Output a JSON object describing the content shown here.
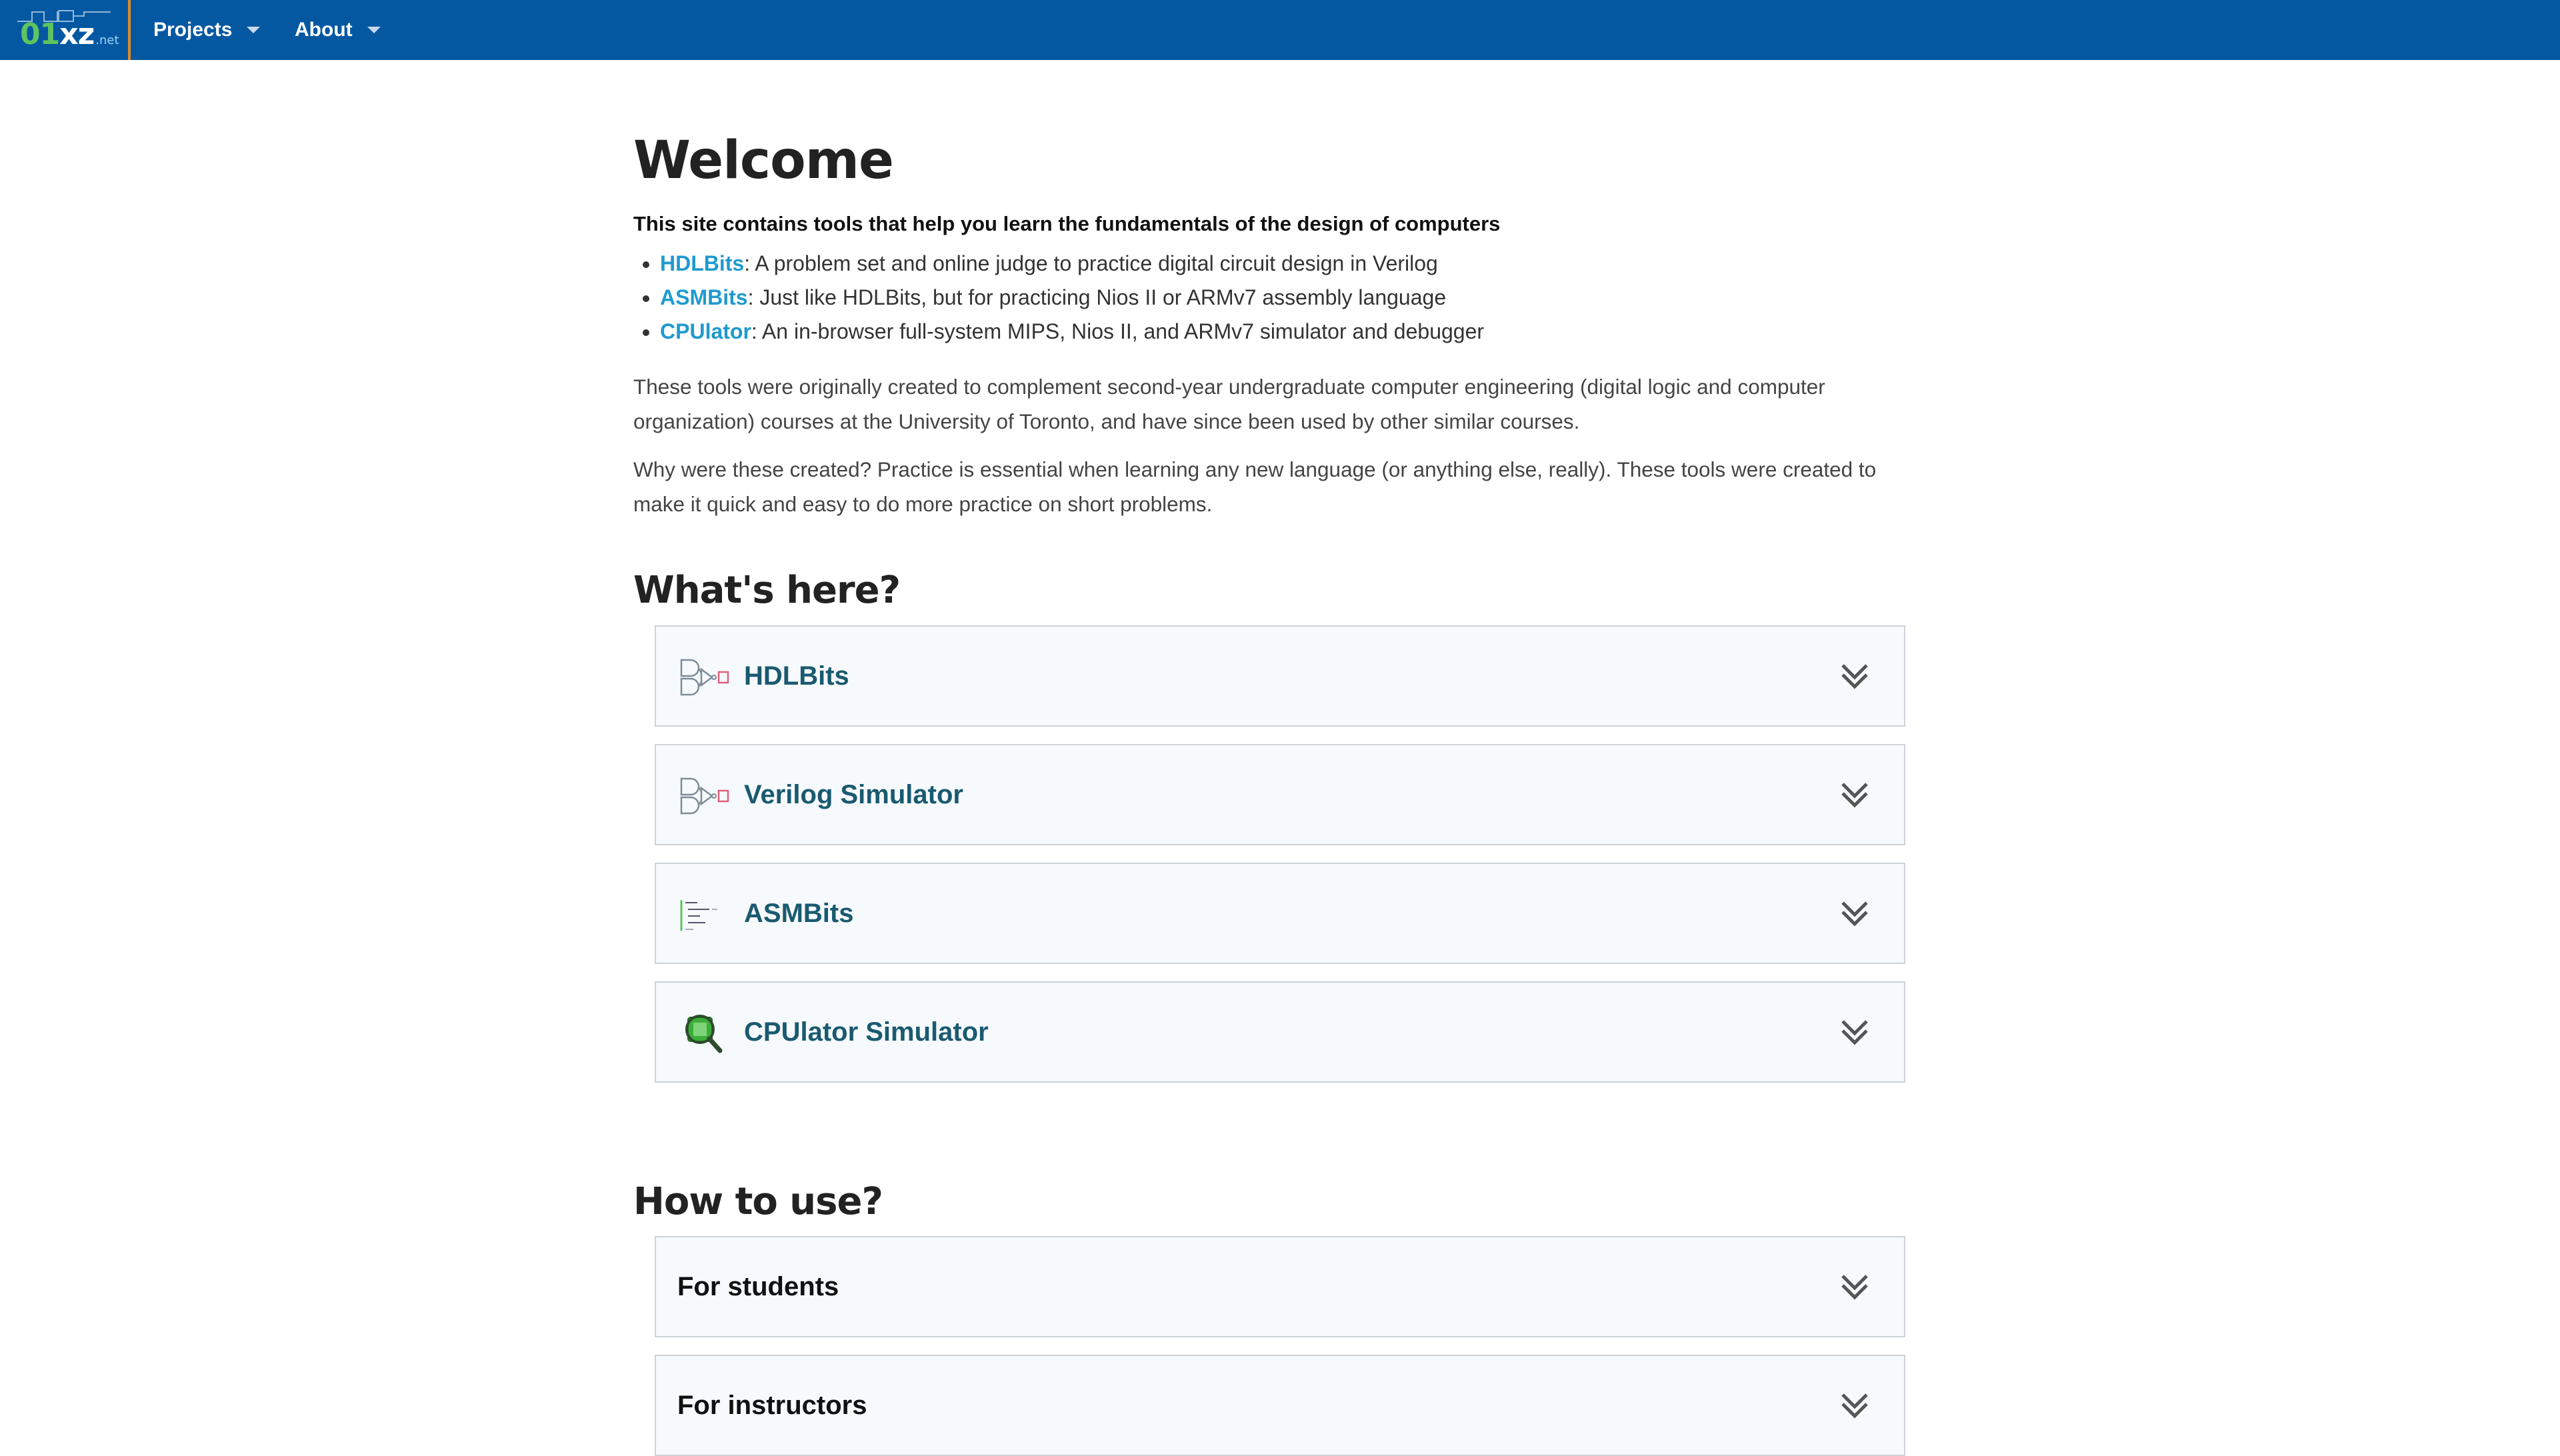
{
  "navbar": {
    "brand": {
      "main": "01",
      "accent": "xz",
      "suffix": ".net"
    },
    "items": [
      {
        "label": "Projects"
      },
      {
        "label": "About"
      }
    ],
    "colors": {
      "background": "#0458a2",
      "brand_border": "#e08a2c"
    }
  },
  "welcome": {
    "title": "Welcome",
    "lead": "This site contains tools that help you learn the fundamentals of the design of computers",
    "tools": [
      {
        "name": "HDLBits",
        "desc": ": A problem set and online judge to practice digital circuit design in Verilog"
      },
      {
        "name": "ASMBits",
        "desc": ": Just like HDLBits, but for practicing Nios II or ARMv7 assembly language"
      },
      {
        "name": "CPUlator",
        "desc": ": An in-browser full-system MIPS, Nios II, and ARMv7 simulator and debugger"
      }
    ],
    "para1": "These tools were originally created to complement second-year undergraduate computer engineering (digital logic and computer organization) courses at the University of Toronto, and have since been used by other similar courses.",
    "para2": "Why were these created? Practice is essential when learning any new language (or anything else, really). These tools were created to make it quick and easy to do more practice on short problems."
  },
  "whats_here": {
    "heading": "What's here?",
    "cards": [
      {
        "title": "HDLBits",
        "icon": "logic-gates-icon"
      },
      {
        "title": "Verilog Simulator",
        "icon": "logic-gates-icon"
      },
      {
        "title": "ASMBits",
        "icon": "assembly-code-icon"
      },
      {
        "title": "CPUlator Simulator",
        "icon": "cpu-magnifier-icon"
      }
    ]
  },
  "how_to_use": {
    "heading": "How to use?",
    "cards": [
      {
        "title": "For students"
      },
      {
        "title": "For instructors"
      }
    ]
  }
}
